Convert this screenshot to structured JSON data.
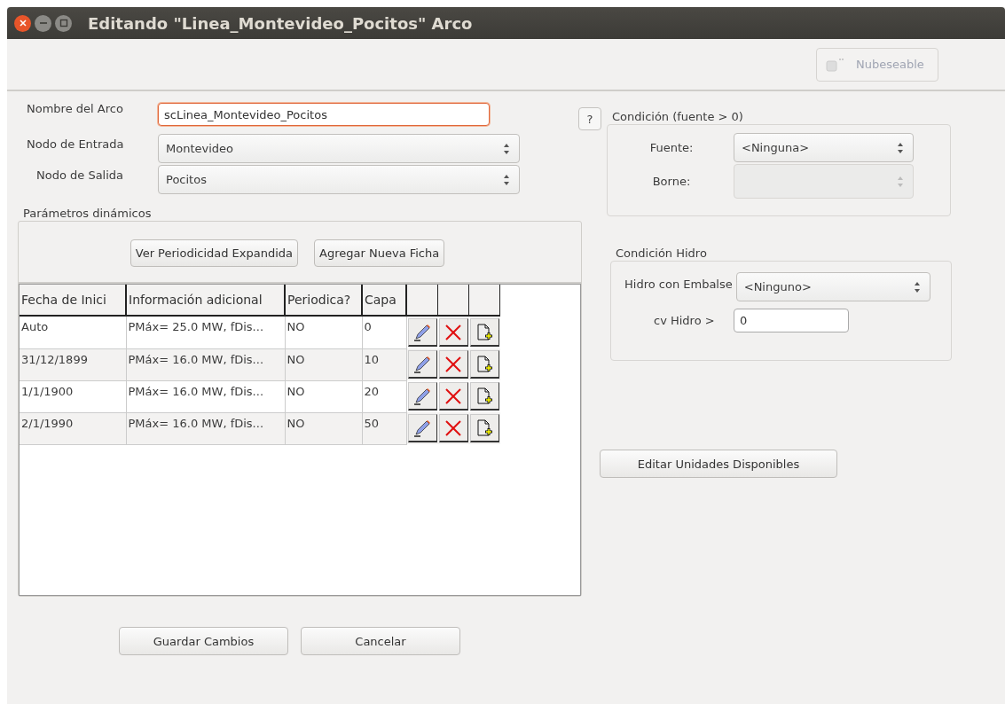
{
  "window": {
    "title": "Editando \"Linea_Montevideo_Pocitos\" Arco"
  },
  "toolbar": {
    "nubeseable": {
      "label": "Nubeseable",
      "disabled": true
    }
  },
  "form": {
    "nombre": {
      "label": "Nombre del Arco",
      "value": "scLinea_Montevideo_Pocitos",
      "focused": true
    },
    "entrada": {
      "label": "Nodo de Entrada",
      "value": "Montevideo"
    },
    "salida": {
      "label": "Nodo de Salida",
      "value": "Pocitos"
    }
  },
  "parametros": {
    "title": "Parámetros dinámicos",
    "buttons": [
      "Ver Periodicidad Expandida",
      "Agregar Nueva Ficha"
    ],
    "columns": [
      "Fecha de Inici",
      "Información adicional",
      "Periodica?",
      "Capa"
    ],
    "rows": [
      {
        "cells": [
          "Auto",
          "PMáx= 25.0 MW, fDis...",
          "NO",
          "0"
        ]
      },
      {
        "cells": [
          "31/12/1899",
          "PMáx= 16.0 MW, fDis...",
          "NO",
          "10"
        ]
      },
      {
        "cells": [
          "1/1/1900",
          "PMáx= 16.0 MW, fDis...",
          "NO",
          "20"
        ]
      },
      {
        "cells": [
          "2/1/1990",
          "PMáx= 16.0 MW, fDis...",
          "NO",
          "50"
        ]
      }
    ]
  },
  "help_button": "?",
  "condicion_fuente": {
    "title": "Condición (fuente > 0)",
    "fuente": {
      "label": "Fuente:",
      "value": "<Ninguna>",
      "disabled": false
    },
    "borne": {
      "label": "Borne:",
      "disabled": true
    }
  },
  "condicion_hidro": {
    "title": "Condición Hidro",
    "embalse": {
      "label": "Hidro con Embalse",
      "value": "<Ninguno>"
    },
    "cv": {
      "label": "cv  Hidro >",
      "value": "0"
    }
  },
  "editar_button": "Editar Unidades Disponibles",
  "footer_buttons": [
    "Guardar Cambios",
    "Cancelar"
  ]
}
